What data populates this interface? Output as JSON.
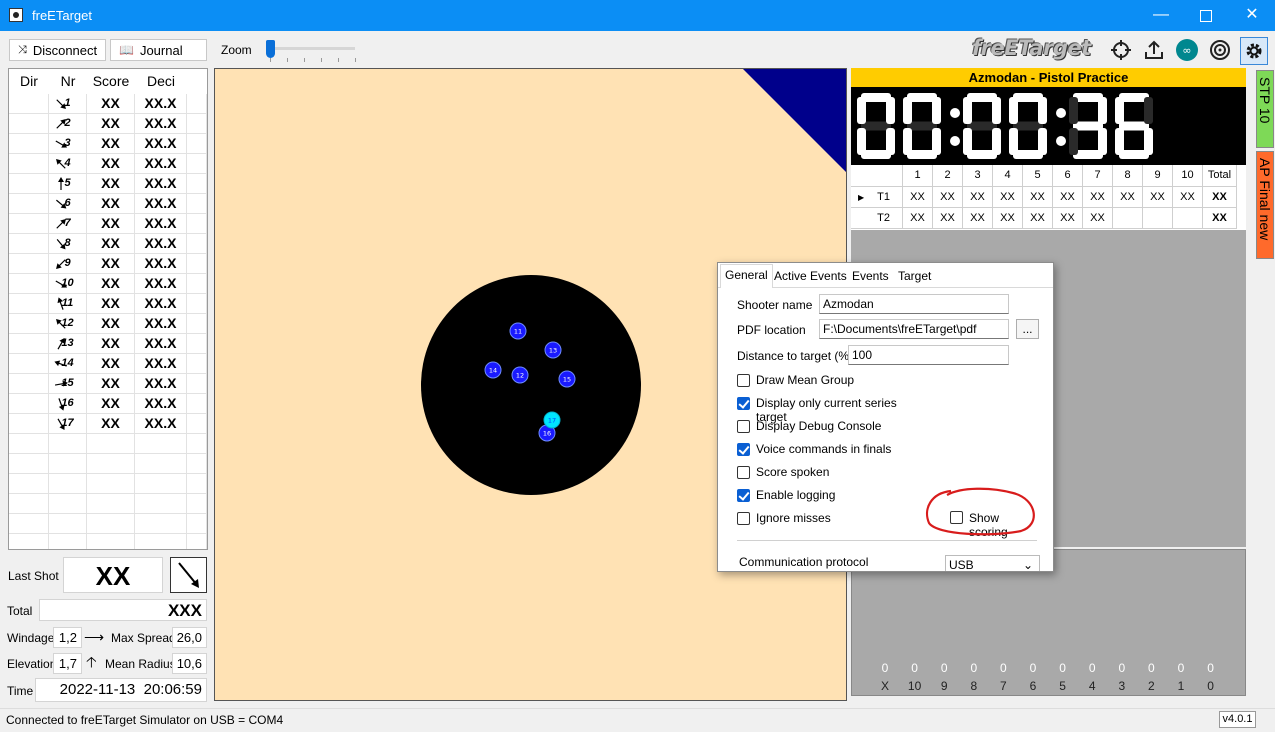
{
  "window": {
    "title": "freETarget"
  },
  "toolbar": {
    "disconnect_label": "Disconnect",
    "journal_label": "Journal",
    "zoom_label": "Zoom",
    "logo_text": "freETarget",
    "icons": [
      "crosshair-icon",
      "upload-icon",
      "arduino-icon",
      "target-icon",
      "settings-icon"
    ]
  },
  "shots": {
    "headers": [
      "Dir",
      "Nr",
      "Score",
      "Deci"
    ],
    "rows": [
      {
        "dir": 135,
        "nr": "1",
        "score": "XX",
        "deci": "XX.X"
      },
      {
        "dir": 45,
        "nr": "2",
        "score": "XX",
        "deci": "XX.X"
      },
      {
        "dir": 120,
        "nr": "3",
        "score": "XX",
        "deci": "XX.X"
      },
      {
        "dir": -45,
        "nr": "4",
        "score": "XX",
        "deci": "XX.X"
      },
      {
        "dir": 0,
        "nr": "5",
        "score": "XX",
        "deci": "XX.X"
      },
      {
        "dir": 130,
        "nr": "6",
        "score": "XX",
        "deci": "XX.X"
      },
      {
        "dir": 45,
        "nr": "7",
        "score": "XX",
        "deci": "XX.X"
      },
      {
        "dir": 140,
        "nr": "8",
        "score": "XX",
        "deci": "XX.X"
      },
      {
        "dir": -135,
        "nr": "9",
        "score": "XX",
        "deci": "XX.X"
      },
      {
        "dir": 120,
        "nr": "10",
        "score": "XX",
        "deci": "XX.X"
      },
      {
        "dir": -20,
        "nr": "11",
        "score": "XX",
        "deci": "XX.X"
      },
      {
        "dir": -45,
        "nr": "12",
        "score": "XX",
        "deci": "XX.X"
      },
      {
        "dir": 30,
        "nr": "13",
        "score": "XX",
        "deci": "XX.X"
      },
      {
        "dir": -70,
        "nr": "14",
        "score": "XX",
        "deci": "XX.X"
      },
      {
        "dir": 80,
        "nr": "15",
        "score": "XX",
        "deci": "XX.X"
      },
      {
        "dir": 160,
        "nr": "16",
        "score": "XX",
        "deci": "XX.X"
      },
      {
        "dir": 150,
        "nr": "17",
        "score": "XX",
        "deci": "XX.X"
      }
    ]
  },
  "last_shot": {
    "label": "Last Shot",
    "value": "XX"
  },
  "stats": {
    "total_label": "Total",
    "total_value": "XXX",
    "windage_label": "Windage",
    "windage_value": "1,2",
    "max_spread_label": "Max Spread",
    "max_spread_value": "26,0",
    "elevation_label": "Elevation",
    "elevation_value": "1,7",
    "mean_radius_label": "Mean Radius",
    "mean_radius_value": "10,6",
    "time_label": "Time",
    "time_value": "2022-11-13  20:06:59"
  },
  "target": {
    "impacts": [
      {
        "label": "11",
        "current": false
      },
      {
        "label": "12",
        "current": false
      },
      {
        "label": "13",
        "current": false
      },
      {
        "label": "14",
        "current": false
      },
      {
        "label": "15",
        "current": false
      },
      {
        "label": "16",
        "current": false
      },
      {
        "label": "17",
        "current": true
      }
    ]
  },
  "event": {
    "title": "Azmodan - Pistol Practice",
    "clock": "00:00:36",
    "columns": [
      "",
      "1",
      "2",
      "3",
      "4",
      "5",
      "6",
      "7",
      "8",
      "9",
      "10",
      "Total"
    ],
    "series": [
      {
        "name": "T1",
        "values": [
          "XX",
          "XX",
          "XX",
          "XX",
          "XX",
          "XX",
          "XX",
          "XX",
          "XX",
          "XX"
        ],
        "total": "XX"
      },
      {
        "name": "T2",
        "values": [
          "XX",
          "XX",
          "XX",
          "XX",
          "XX",
          "XX",
          "XX",
          "",
          "",
          ""
        ],
        "total": "XX"
      }
    ]
  },
  "histogram": {
    "counts": [
      "0",
      "0",
      "0",
      "0",
      "0",
      "0",
      "0",
      "0",
      "0",
      "0",
      "0",
      "0"
    ],
    "rings": [
      "X",
      "10",
      "9",
      "8",
      "7",
      "6",
      "5",
      "4",
      "3",
      "2",
      "1",
      "0"
    ]
  },
  "side_tabs": [
    {
      "label": "STP 10",
      "color": "#7ed957"
    },
    {
      "label": "AP Final new",
      "color": "#ff6a2b"
    }
  ],
  "dialog": {
    "tabs": [
      "General",
      "Active Events",
      "Events",
      "Target"
    ],
    "shooter_name_label": "Shooter name",
    "shooter_name_value": "Azmodan",
    "pdf_location_label": "PDF location",
    "pdf_location_value": "F:\\Documents\\freETarget\\pdf",
    "browse_label": "...",
    "distance_label": "Distance to target (%)",
    "distance_value": "100",
    "checkboxes": [
      {
        "label": "Draw Mean Group",
        "checked": false
      },
      {
        "label": "Display only current series target",
        "checked": true
      },
      {
        "label": "Display Debug Console",
        "checked": false
      },
      {
        "label": "Voice commands in finals",
        "checked": true
      },
      {
        "label": "Score spoken",
        "checked": false
      },
      {
        "label": "Enable logging",
        "checked": true
      },
      {
        "label": "Ignore misses",
        "checked": false
      }
    ],
    "show_scoring_label": "Show scoring",
    "show_scoring_checked": false,
    "protocol_label": "Communication protocol",
    "protocol_value": "USB"
  },
  "status": {
    "text": "Connected to freETarget Simulator on USB = COM4",
    "version": "v4.0.1"
  }
}
